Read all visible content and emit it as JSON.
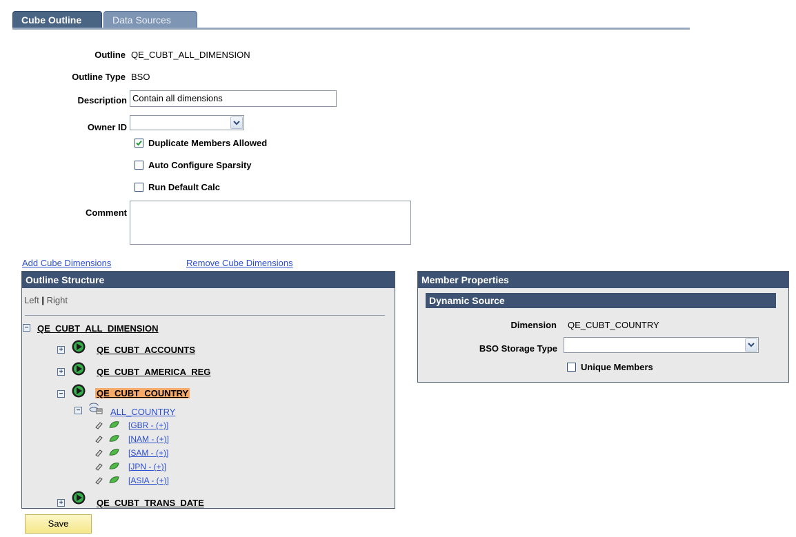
{
  "tabs": [
    {
      "label": "Cube Outline",
      "active": true
    },
    {
      "label": "Data Sources",
      "active": false
    }
  ],
  "form": {
    "outline_label": "Outline",
    "outline_value": "QE_CUBT_ALL_DIMENSION",
    "outline_type_label": "Outline Type",
    "outline_type_value": "BSO",
    "description_label": "Description",
    "description_value": "Contain all dimensions",
    "owner_label": "Owner ID",
    "owner_value": "",
    "checkboxes": [
      {
        "label": "Duplicate Members Allowed",
        "checked": true
      },
      {
        "label": "Auto Configure Sparsity",
        "checked": false
      },
      {
        "label": "Run Default Calc",
        "checked": false
      }
    ],
    "comment_label": "Comment",
    "comment_value": ""
  },
  "links": {
    "add": "Add Cube Dimensions",
    "remove": "Remove Cube Dimensions"
  },
  "outline_structure": {
    "title": "Outline Structure",
    "left": "Left",
    "sep": "|",
    "right": "Right",
    "root": "QE_CUBT_ALL_DIMENSION",
    "dimensions": [
      {
        "label": "QE_CUBT_ACCOUNTS",
        "expanded": false
      },
      {
        "label": "QE_CUBT_AMERICA_REG",
        "expanded": false
      },
      {
        "label": "QE_CUBT_COUNTRY",
        "expanded": true,
        "selected": true
      },
      {
        "label": "QE_CUBT_TRANS_DATE",
        "expanded": false
      }
    ],
    "member": "ALL_COUNTRY",
    "leaves": [
      "[GBR - (+)]",
      "[NAM - (+)]",
      "[SAM - (+)]",
      "[JPN - (+)]",
      "[ASIA - (+)]"
    ]
  },
  "member_properties": {
    "title": "Member Properties",
    "section": "Dynamic Source",
    "dimension_label": "Dimension",
    "dimension_value": "QE_CUBT_COUNTRY",
    "storage_label": "BSO Storage Type",
    "storage_value": "",
    "unique_label": "Unique Members",
    "unique_checked": false
  },
  "save_label": "Save",
  "colors": {
    "header": "#3e5373",
    "link": "#2c4fd0",
    "selected": "#f7a968"
  }
}
